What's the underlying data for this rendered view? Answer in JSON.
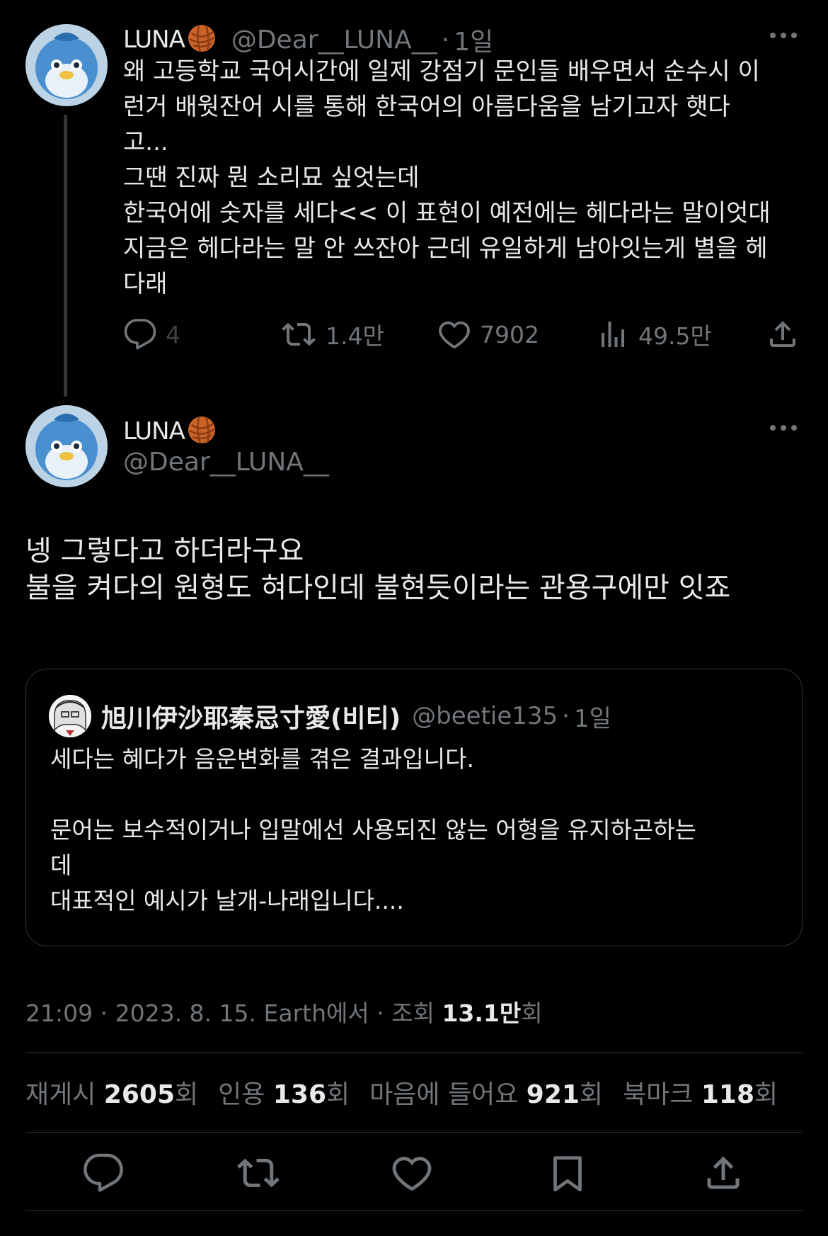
{
  "original_post": {
    "display_name": "LUNA",
    "handle": "@Dear__LUNA__",
    "time": "1일",
    "text": "왜 고등학교 국어시간에 일제 강점기 문인들 배우면서 순수시 이\n런거 배웟잔어 시를 통해 한국어의 아름다움을 남기고자 햇다\n고...\n그땐 진짜 뭔 소리묘 싶엇는데\n한국어에 숫자를 세다<< 이 표현이 예전에는 헤다라는 말이엇대\n지금은 헤다라는 말 안 쓰잔아 근데 유일하게 남아잇는게 별을 헤\n다래",
    "replies": "4",
    "reposts": "1.4만",
    "likes": "7902",
    "views": "49.5만"
  },
  "reply_post": {
    "display_name": "LUNA",
    "handle": "@Dear__LUNA__",
    "text": "넹 그렇다고 하더라구요\n불을 켜다의 원형도 혀다인데 불현듯이라는 관용구에만 잇죠"
  },
  "quoted_post": {
    "display_name": "旭川伊沙耶秦忌寸愛(비티)",
    "handle": "@beetie135",
    "time": "1일",
    "text": "세다는 혜다가 음운변화를 겪은 결과입니다.\n\n문어는 보수적이거나 입말에선 사용되진 않는 어형을 유지하곤하는\n데\n대표적인 예시가 날개-나래입니다...."
  },
  "meta": {
    "time": "21:09",
    "date": "2023. 8. 15.",
    "source": "Earth에서",
    "views_label": "조회",
    "views_value": "13.1만",
    "views_suffix": "회"
  },
  "stats": {
    "reposts_label": "재게시",
    "reposts_value": "2605",
    "quotes_label": "인용",
    "quotes_value": "136",
    "likes_label": "마음에 들어요",
    "likes_value": "921",
    "bookmarks_label": "북마크",
    "bookmarks_value": "118",
    "suffix": "회"
  },
  "icons": {
    "reply": "reply-icon",
    "repost": "repost-icon",
    "like": "heart-icon",
    "views": "views-icon",
    "share": "share-icon",
    "bookmark": "bookmark-icon",
    "more": "more-icon"
  },
  "colors": {
    "background": "#000000",
    "text": "#e7e9ea",
    "secondary": "#71767b",
    "border": "#2f3336"
  }
}
